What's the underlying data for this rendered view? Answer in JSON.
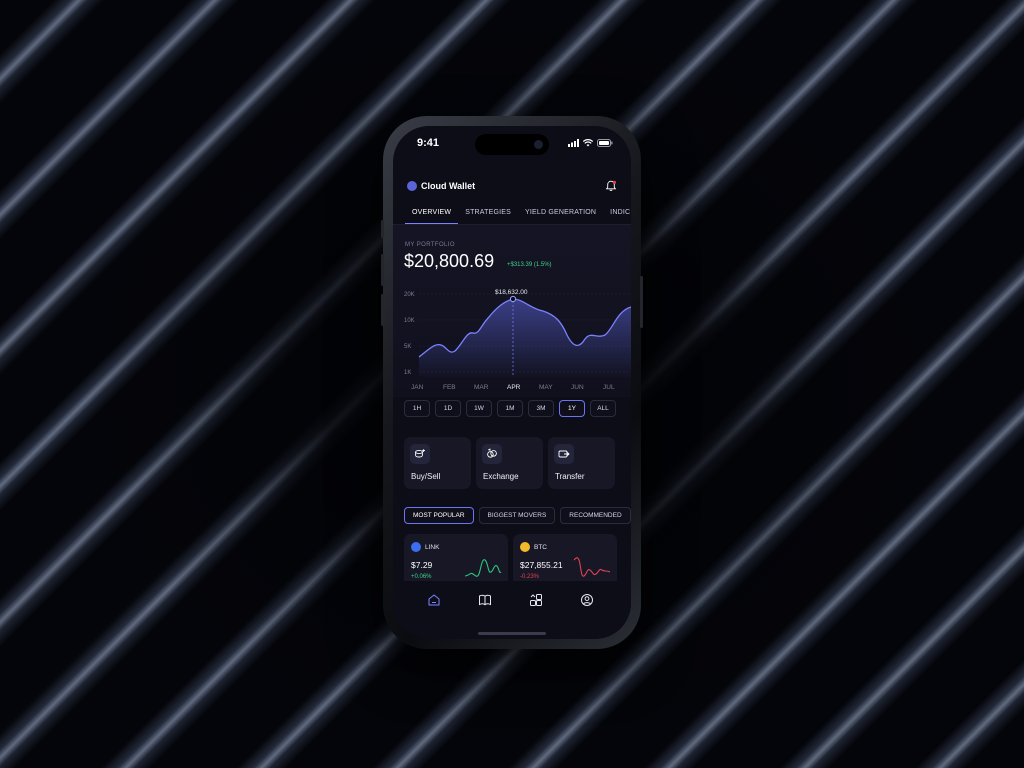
{
  "status_bar": {
    "time": "9:41"
  },
  "header": {
    "app_name": "Cloud Wallet",
    "bell_icon": "bell-icon"
  },
  "tabs": [
    {
      "label": "OVERVIEW",
      "active": true
    },
    {
      "label": "STRATEGIES",
      "active": false
    },
    {
      "label": "YIELD GENERATION",
      "active": false
    },
    {
      "label": "INDIC",
      "active": false
    }
  ],
  "portfolio": {
    "label": "MY PORTFOLIO",
    "value": "$20,800.69",
    "change": "+$313.39 (1.5%)"
  },
  "chart_data": {
    "type": "area",
    "categories": [
      "JAN",
      "FEB",
      "MAR",
      "APR",
      "MAY",
      "JUN",
      "JUL"
    ],
    "y_tick_labels": [
      "20K",
      "10K",
      "5K",
      "1K"
    ],
    "highlight": {
      "category": "APR",
      "label": "$18,632.00"
    },
    "accent_color": "#7a82ff"
  },
  "ranges": [
    {
      "label": "1H",
      "active": false
    },
    {
      "label": "1D",
      "active": false
    },
    {
      "label": "1W",
      "active": false
    },
    {
      "label": "1M",
      "active": false
    },
    {
      "label": "3M",
      "active": false
    },
    {
      "label": "1Y",
      "active": true
    },
    {
      "label": "ALL",
      "active": false
    }
  ],
  "actions": [
    {
      "label": "Buy/Sell",
      "icon": "coins-icon"
    },
    {
      "label": "Exchange",
      "icon": "exchange-icon"
    },
    {
      "label": "Transfer",
      "icon": "transfer-icon"
    }
  ],
  "filters": [
    {
      "label": "MOST POPULAR",
      "active": true
    },
    {
      "label": "BIGGEST MOVERS",
      "active": false
    },
    {
      "label": "RECOMMENDED",
      "active": false
    }
  ],
  "coins": [
    {
      "ticker": "LINK",
      "price": "$7.29",
      "change": "+0.06%",
      "trend": "up",
      "logo_color": "#3b6ef0",
      "trend_color": "#2fc77a"
    },
    {
      "ticker": "BTC",
      "price": "$27,855.21",
      "change": "-0.23%",
      "trend": "down",
      "logo_color": "#f2b92a",
      "trend_color": "#e0434f"
    }
  ],
  "nav": [
    {
      "name": "home",
      "icon": "home-icon",
      "active": true
    },
    {
      "name": "learn",
      "icon": "book-icon",
      "active": false
    },
    {
      "name": "apps",
      "icon": "apps-icon",
      "active": false
    },
    {
      "name": "profile",
      "icon": "profile-icon",
      "active": false
    }
  ],
  "colors": {
    "accent": "#7a82ff",
    "positive": "#3fd28a",
    "negative": "#e0434f",
    "screen_bg": "#0d0d18"
  }
}
